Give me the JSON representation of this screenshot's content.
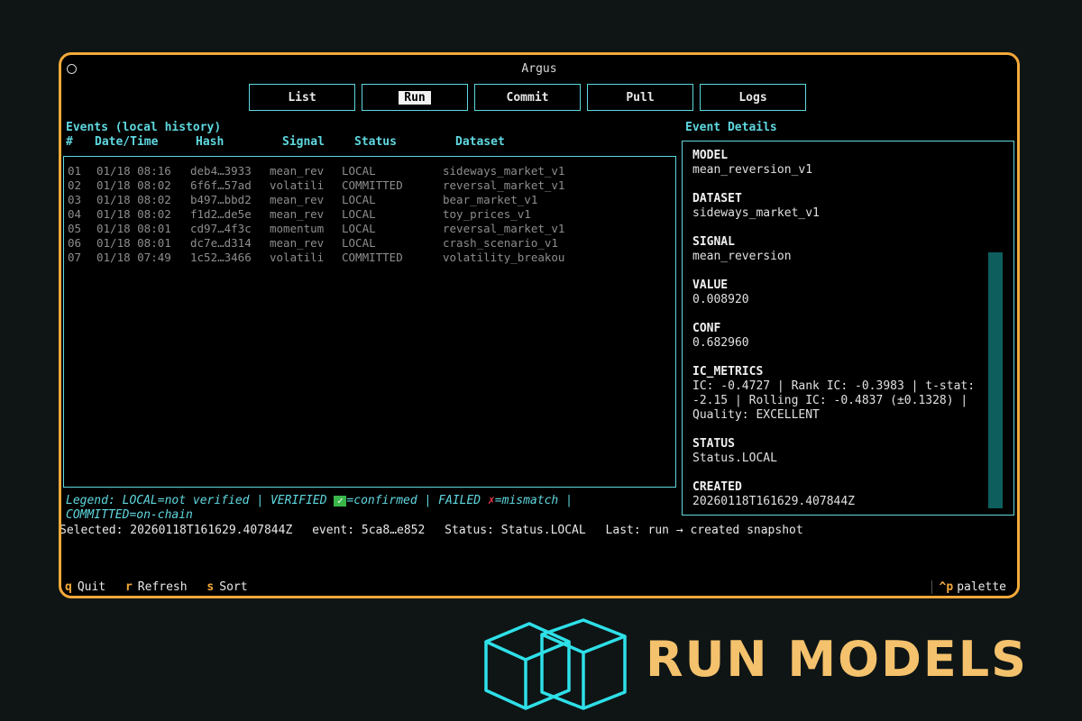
{
  "window": {
    "title": "Argus"
  },
  "tabs": [
    {
      "label": "List",
      "active": false
    },
    {
      "label": "Run",
      "active": true
    },
    {
      "label": "Commit",
      "active": false
    },
    {
      "label": "Pull",
      "active": false
    },
    {
      "label": "Logs",
      "active": false
    }
  ],
  "events": {
    "title": "Events (local history)",
    "columns": [
      "#",
      "Date/Time",
      "Hash",
      "Signal",
      "Status",
      "Dataset"
    ],
    "rows": [
      [
        "01",
        "01/18 08:16",
        "deb4…3933",
        "mean_rev",
        "LOCAL",
        "sideways_market_v1"
      ],
      [
        "02",
        "01/18 08:02",
        "6f6f…57ad",
        "volatili",
        "COMMITTED",
        "reversal_market_v1"
      ],
      [
        "03",
        "01/18 08:02",
        "b497…bbd2",
        "mean_rev",
        "LOCAL",
        "bear_market_v1"
      ],
      [
        "04",
        "01/18 08:02",
        "f1d2…de5e",
        "mean_rev",
        "LOCAL",
        "toy_prices_v1"
      ],
      [
        "05",
        "01/18 08:01",
        "cd97…4f3c",
        "momentum",
        "LOCAL",
        "reversal_market_v1"
      ],
      [
        "06",
        "01/18 08:01",
        "dc7e…d314",
        "mean_rev",
        "LOCAL",
        "crash_scenario_v1"
      ],
      [
        "07",
        "01/18 07:49",
        "1c52…3466",
        "volatili",
        "COMMITTED",
        "volatility_breakou"
      ]
    ]
  },
  "legend": {
    "part1": "Legend: LOCAL=not verified | VERIFIED ",
    "check": "✓",
    "part2": "=confirmed | FAILED ",
    "cross": "✗",
    "part3": "=mismatch |",
    "part4": "COMMITTED=on-chain"
  },
  "selected": {
    "selected": "Selected: 20260118T161629.407844Z",
    "event": "event: 5ca8…e852",
    "status": "Status: Status.LOCAL",
    "last": "Last: run → created snapshot"
  },
  "details": {
    "title": "Event Details",
    "fields": [
      {
        "key": "MODEL",
        "value": "mean_reversion_v1"
      },
      {
        "key": "DATASET",
        "value": "sideways_market_v1"
      },
      {
        "key": "SIGNAL",
        "value": "mean_reversion"
      },
      {
        "key": "VALUE",
        "value": "0.008920"
      },
      {
        "key": "CONF",
        "value": "0.682960"
      },
      {
        "key": "IC_METRICS",
        "value": "IC: -0.4727 | Rank IC: -0.3983 | t-stat: -2.15 | Rolling IC: -0.4837 (±0.1328) | Quality: EXCELLENT"
      },
      {
        "key": "STATUS",
        "value": "Status.LOCAL"
      },
      {
        "key": "CREATED",
        "value": "20260118T161629.407844Z"
      }
    ]
  },
  "footer": {
    "keys": [
      {
        "key": "q",
        "label": "Quit"
      },
      {
        "key": "r",
        "label": "Refresh"
      },
      {
        "key": "s",
        "label": "Sort"
      }
    ],
    "palette_key": "^p",
    "palette_label": "palette"
  },
  "brand": {
    "text": "RUN MODELS"
  },
  "colors": {
    "accent": "#5fd8e0",
    "border": "#f4a93a",
    "brand": "#f4c16c",
    "scrollbar": "#0e5e5e"
  }
}
